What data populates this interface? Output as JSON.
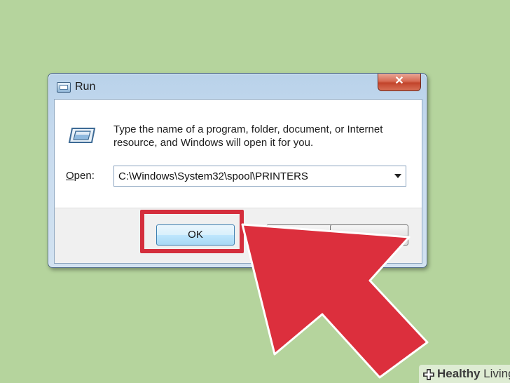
{
  "dialog": {
    "title": "Run",
    "close_label": "✕",
    "message": "Type the name of a program, folder, document, or Internet resource, and Windows will open it for you.",
    "open_label_mnemonic": "O",
    "open_label_rest": "pen:",
    "open_value": "C:\\Windows\\System32\\spool\\PRINTERS",
    "ok_label": "OK",
    "cancel_label": "",
    "browse_label": ""
  },
  "overlay": {
    "highlight_color": "#d42e3c",
    "arrow_color": "#dc2f3d",
    "arrow_icon": "pointer-arrow"
  },
  "watermark": {
    "bold": "Healthy",
    "rest": " Living"
  },
  "colors": {
    "background": "#b5d49d"
  }
}
